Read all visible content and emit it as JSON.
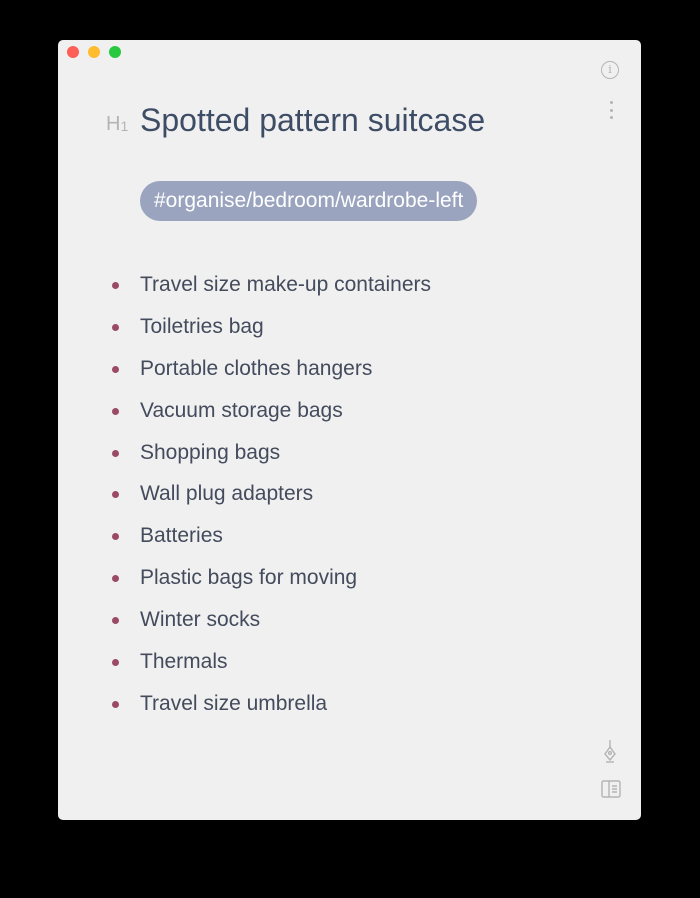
{
  "window": {
    "traffic_lights": [
      "close",
      "minimize",
      "zoom"
    ]
  },
  "toolbar": {
    "info_icon": "info-icon",
    "info_glyph": "i",
    "more_icon": "more-vertical-icon"
  },
  "note": {
    "heading_marker": "H",
    "heading_level": "1",
    "title": "Spotted pattern suitcase",
    "tag": "#organise/bedroom/wardrobe-left",
    "items": [
      "Travel size make-up containers",
      "Toiletries bag",
      "Portable clothes hangers",
      "Vacuum storage bags",
      "Shopping bags",
      "Wall plug adapters",
      "Batteries",
      "Plastic bags for moving",
      "Winter socks",
      "Thermals",
      "Travel size umbrella"
    ]
  },
  "footer": {
    "edit_icon": "pen-nib-icon",
    "sidebar_icon": "sidebar-toggle-icon"
  },
  "colors": {
    "background": "#000000",
    "window": "#f0f0f0",
    "title": "#3e4d66",
    "tag_fill": "#9aa4bf",
    "tag_text": "#ffffff",
    "bullet": "#9a4a66",
    "item_text": "#434b5c",
    "muted_icon": "#b4b4b4"
  }
}
